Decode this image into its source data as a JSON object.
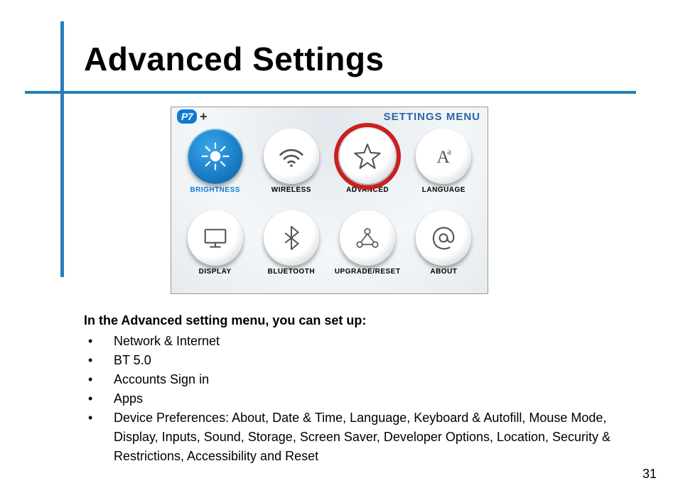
{
  "title": "Advanced Settings",
  "pageNumber": "31",
  "menu": {
    "logo_p7": "P7",
    "logo_plus": "+",
    "header": "SETTINGS MENU",
    "items": [
      {
        "label": "BRIGHTNESS"
      },
      {
        "label": "WIRELESS"
      },
      {
        "label": "ADVANCED"
      },
      {
        "label": "LANGUAGE"
      },
      {
        "label": "DISPLAY"
      },
      {
        "label": "BLUETOOTH"
      },
      {
        "label": "UPGRADE/RESET"
      },
      {
        "label": "ABOUT"
      }
    ]
  },
  "body": {
    "lead": "In the Advanced setting menu, you can set up:",
    "bullets": [
      "Network & Internet",
      "BT 5.0",
      "Accounts Sign in",
      "Apps",
      "Device Preferences:  About, Date & Time, Language, Keyboard & Autofill, Mouse Mode, Display, Inputs, Sound, Storage, Screen Saver, Developer Options, Location, Security & Restrictions, Accessibility and Reset"
    ]
  }
}
